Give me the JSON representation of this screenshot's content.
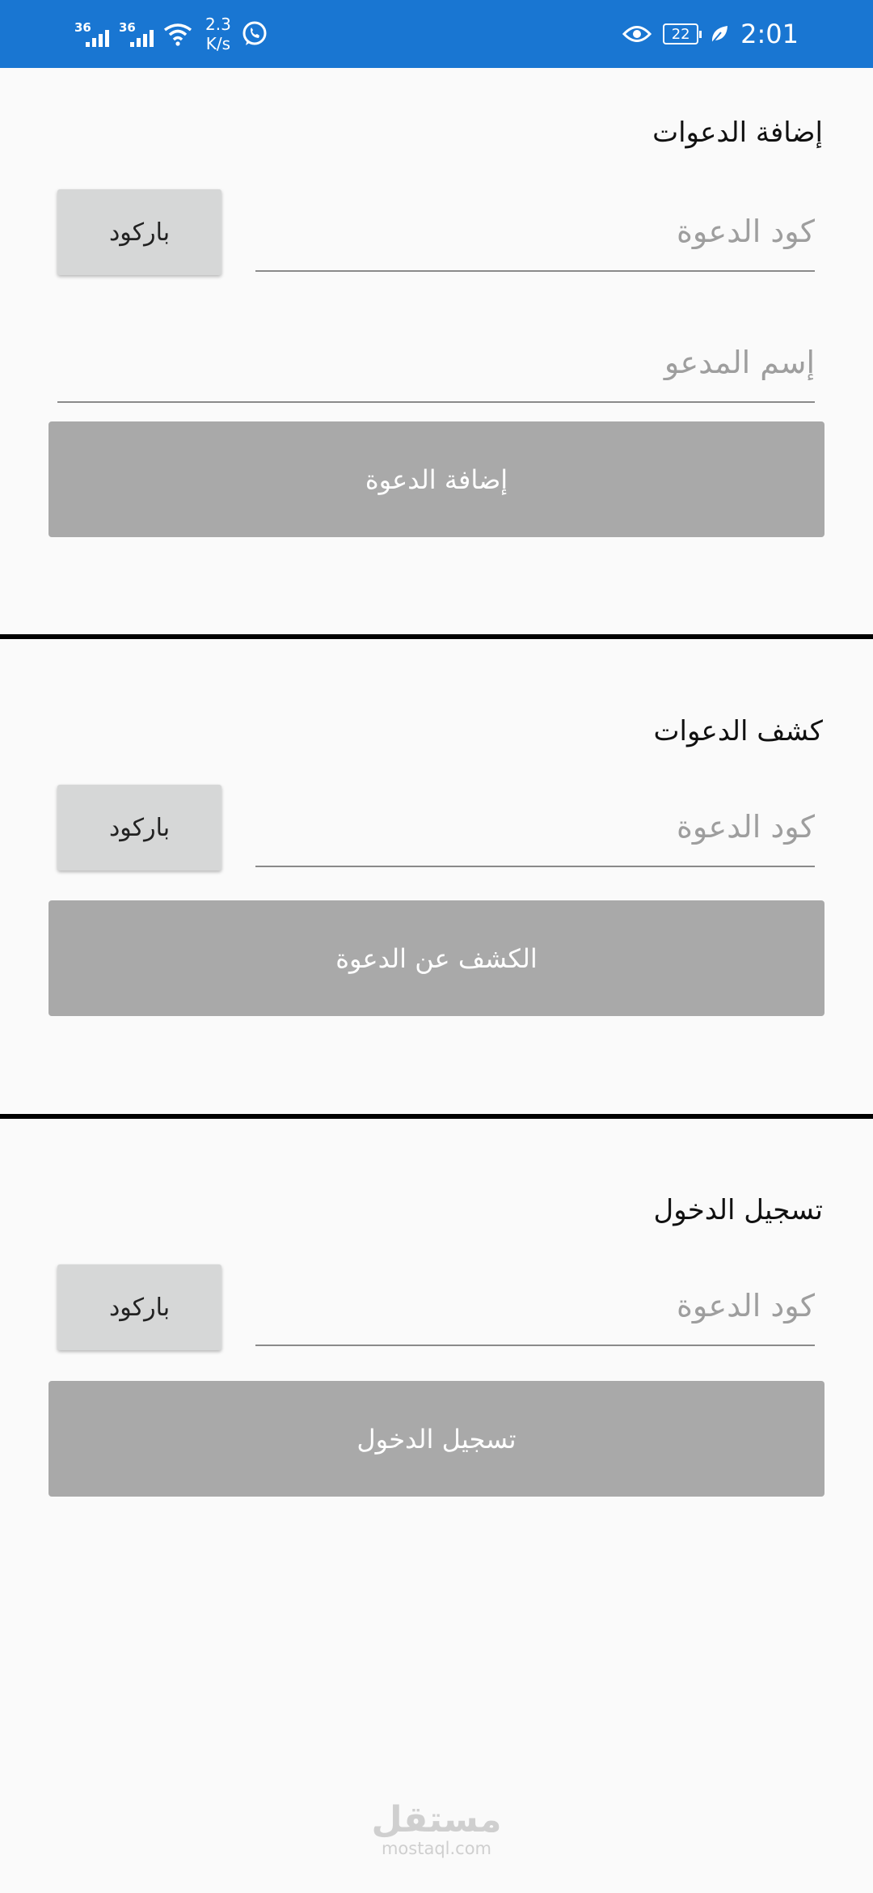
{
  "status_bar": {
    "network1": "36",
    "network2": "36",
    "speed_value": "2.3",
    "speed_unit": "K/s",
    "battery_level": "22",
    "time": "2:01"
  },
  "add_section": {
    "title": "إضافة الدعوات",
    "code_placeholder": "كود الدعوة",
    "name_placeholder": "إسم المدعو",
    "barcode_label": "باركود",
    "submit_label": "إضافة الدعوة"
  },
  "search_section": {
    "title": "كشف الدعوات",
    "code_placeholder": "كود الدعوة",
    "barcode_label": "باركود",
    "submit_label": "الكشف عن الدعوة"
  },
  "login_section": {
    "title": "تسجيل الدخول",
    "code_placeholder": "كود الدعوة",
    "barcode_label": "باركود",
    "submit_label": "تسجيل الدخول"
  },
  "watermark": {
    "arabic": "مستقل",
    "latin": "mostaql.com"
  },
  "colors": {
    "status_bar": "#1976d2",
    "button_gray": "#a9a9a9",
    "barcode_gray": "#d6d7d7",
    "background": "#fafafa"
  }
}
